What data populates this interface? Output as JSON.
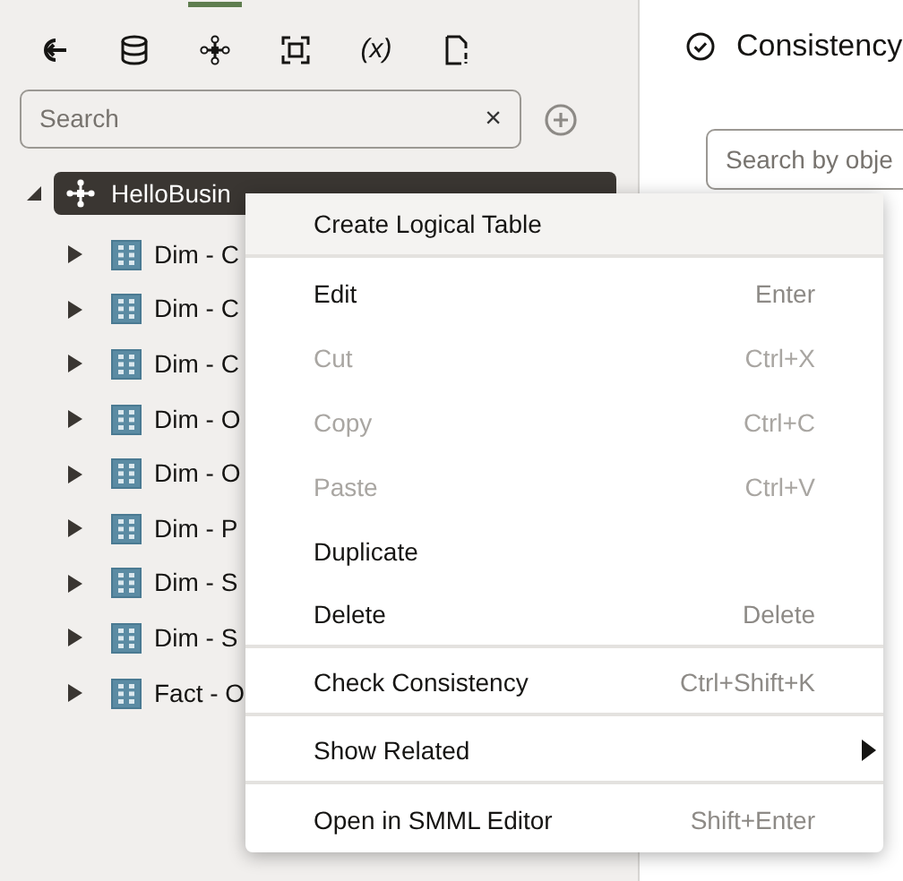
{
  "toolbar": {
    "tools": [
      {
        "kind": "import",
        "selected": false
      },
      {
        "kind": "database",
        "selected": false
      },
      {
        "kind": "model",
        "selected": true
      },
      {
        "kind": "frame",
        "selected": false
      },
      {
        "kind": "variable",
        "label": "(x)",
        "selected": false
      },
      {
        "kind": "document",
        "selected": false
      }
    ]
  },
  "search": {
    "placeholder": "Search",
    "clear": "×"
  },
  "tree": {
    "root": {
      "label": "HelloBusin",
      "expanded": true,
      "selected": true,
      "children": [
        {
          "label": "Dim - C",
          "expanded": false
        },
        {
          "label": "Dim - C",
          "expanded": false
        },
        {
          "label": "Dim - C",
          "expanded": false
        },
        {
          "label": "Dim - O",
          "expanded": false
        },
        {
          "label": "Dim - O",
          "expanded": false
        },
        {
          "label": "Dim - P",
          "expanded": false
        },
        {
          "label": "Dim - S",
          "expanded": false
        },
        {
          "label": "Dim - S",
          "expanded": false
        },
        {
          "label": "Fact - O",
          "expanded": false
        }
      ]
    }
  },
  "right_panel": {
    "title": "Consistency",
    "search": {
      "placeholder": "Search by obje"
    }
  },
  "context_menu": [
    {
      "label": "Create Logical Table",
      "disabled": false,
      "selected": true,
      "separator_after": true,
      "submenu": false
    },
    {
      "label": "Edit",
      "shortcut": "Enter",
      "disabled": false,
      "selected": false,
      "separator_after": false,
      "submenu": false
    },
    {
      "label": "Cut",
      "shortcut": "Ctrl+X",
      "disabled": true,
      "selected": false,
      "separator_after": false,
      "submenu": false
    },
    {
      "label": "Copy",
      "shortcut": "Ctrl+C",
      "disabled": true,
      "selected": false,
      "separator_after": false,
      "submenu": false
    },
    {
      "label": "Paste",
      "shortcut": "Ctrl+V",
      "disabled": true,
      "selected": false,
      "separator_after": false,
      "submenu": false
    },
    {
      "label": "Duplicate",
      "disabled": false,
      "selected": false,
      "separator_after": false,
      "submenu": false
    },
    {
      "label": "Delete",
      "shortcut": "Delete",
      "disabled": false,
      "selected": false,
      "separator_after": true,
      "submenu": false
    },
    {
      "label": "Check Consistency",
      "shortcut": "Ctrl+Shift+K",
      "disabled": false,
      "selected": false,
      "separator_after": true,
      "submenu": false
    },
    {
      "label": "Show Related",
      "disabled": false,
      "selected": false,
      "separator_after": true,
      "submenu": true
    },
    {
      "label": "Open in SMML Editor",
      "shortcut": "Shift+Enter",
      "disabled": false,
      "selected": false,
      "separator_after": false,
      "submenu": false
    }
  ]
}
